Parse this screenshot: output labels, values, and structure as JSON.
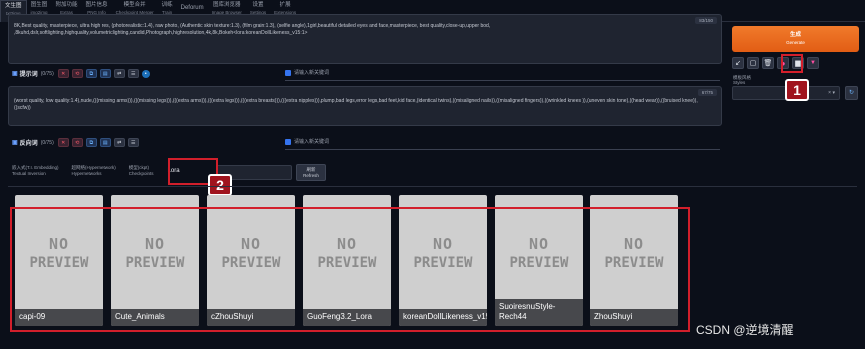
{
  "tabs": [
    {
      "label": "文生图",
      "sub": "txt2img",
      "active": true
    },
    {
      "label": "图生图",
      "sub": "img2img"
    },
    {
      "label": "附加功能",
      "sub": "Extras"
    },
    {
      "label": "图片信息",
      "sub": "PNG Info"
    },
    {
      "label": "模型合并",
      "sub": "Checkpoint Merger"
    },
    {
      "label": "训练",
      "sub": "Train"
    },
    {
      "label": "Deforum",
      "sub": ""
    },
    {
      "label": "图库浏览器",
      "sub": "Image Browser"
    },
    {
      "label": "设置",
      "sub": "Settings"
    },
    {
      "label": "扩展",
      "sub": "Extensions"
    }
  ],
  "positive": {
    "text": "8K,Best quality, masterpiece, ultra high res, (photorealistic:1.4), raw photo, (Authentic skin texture:1.3), (film grain:1.3), (selfie angle),1girl,beautiful detailed eyes and face,masterpiece, best quality,close-up,upper bod, ,8kuhd,dslr,softlighting,highquality,volumetriclighting,candid,Photograph,highresolution,4k,8k,Bokeh<lora:koreanDollLikeness_v15:1>",
    "counter": "83/150",
    "label": "提示词",
    "count": "(0/75)",
    "keyword_placeholder": "请输入新关键词"
  },
  "negative": {
    "text": "(worst quality, low quality:1.4),nude,(((missing arms))),(((missing legs))),(((extra arms))),(((extra legs))),(((extra breasts))),(((extra nipples))),plump,bad legs,error legs,bad feet,kid face,(identical twins),((misaligned nails)),((misaligned fingers)),((wrinkled knees )),(uneven skin tone),((head wear)),((bruised knee)),((scfw))",
    "counter": "67/75",
    "label": "反向词",
    "count": "(0/75)",
    "keyword_placeholder": "请输入新关键词"
  },
  "right": {
    "generate": "生成",
    "generate_sub": "Generate",
    "styles_label_1": "模板风格",
    "styles_label_2": "Styles",
    "styles_value": "× ▾"
  },
  "network_tabs": [
    {
      "label": "嵌入式(T.I. Embedding)",
      "sub": "Textual Inversion"
    },
    {
      "label": "超网络(Hypernetwork)",
      "sub": "Hypernetworks"
    },
    {
      "label": "模型(ckpt)",
      "sub": "Checkpoints"
    },
    {
      "label": "Lora",
      "sub": "",
      "active": true
    }
  ],
  "refresh": {
    "label": "刷新",
    "sub": "Refresh"
  },
  "preview_text": [
    "NO",
    "PREVIEW"
  ],
  "cards": [
    {
      "name": "capi-09"
    },
    {
      "name": "Cute_Animals"
    },
    {
      "name": "cZhouShuyi"
    },
    {
      "name": "GuoFeng3.2_Lora"
    },
    {
      "name": "koreanDollLikeness_v15"
    },
    {
      "name": "SuoiresnuStyle-Rech44"
    },
    {
      "name": "ZhouShuyi"
    }
  ],
  "badges": {
    "one": "1",
    "two": "2"
  },
  "watermark": "CSDN @逆境清醒",
  "colors": {
    "generate": "#e8651d",
    "callout": "#d21f2b",
    "background": "#0b0f19"
  }
}
